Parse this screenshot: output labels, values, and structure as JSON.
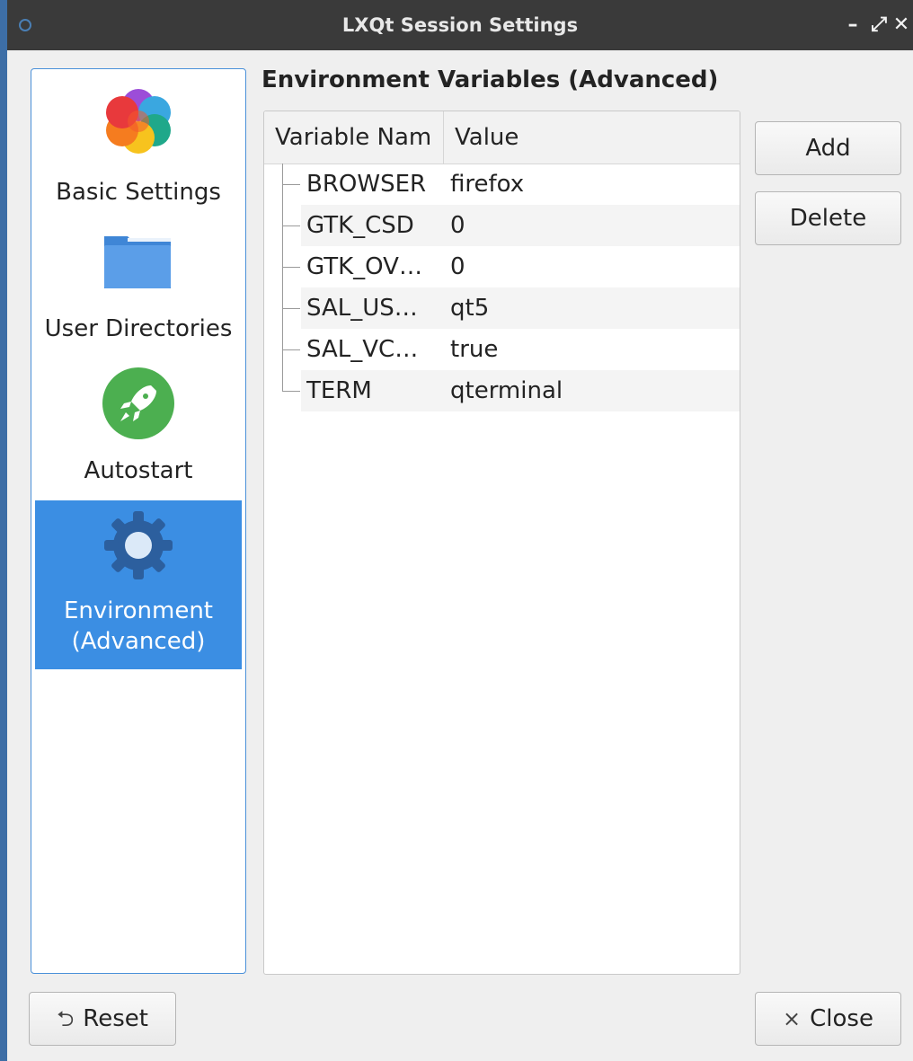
{
  "window": {
    "title": "LXQt Session Settings",
    "minimize_glyph": "–",
    "maximize_glyph": "⤢",
    "close_glyph": "✕"
  },
  "sidebar": {
    "items": [
      {
        "label": "Basic Settings",
        "icon": "preferences-flower-icon"
      },
      {
        "label": "User Directories",
        "icon": "folder-icon"
      },
      {
        "label": "Autostart",
        "icon": "rocket-icon"
      },
      {
        "label": "Environment\n(Advanced)",
        "line1": "Environment",
        "line2": "(Advanced)",
        "icon": "gear-icon",
        "selected": true
      }
    ]
  },
  "main": {
    "title": "Environment Variables (Advanced)",
    "columns": {
      "name": "Variable Nam",
      "value": "Value"
    },
    "rows": [
      {
        "name": "BROWSER",
        "value": "firefox"
      },
      {
        "name": "GTK_CSD",
        "value": "0"
      },
      {
        "name": "GTK_OV…",
        "value": "0"
      },
      {
        "name": "SAL_US…",
        "value": "qt5"
      },
      {
        "name": "SAL_VC…",
        "value": "true"
      },
      {
        "name": "TERM",
        "value": "qterminal"
      }
    ]
  },
  "buttons": {
    "add": "Add",
    "delete": "Delete",
    "reset": "Reset",
    "reset_glyph": "⮌",
    "close": "Close",
    "close_glyph": "×"
  },
  "colors": {
    "selection": "#3b8ee3",
    "titlebar": "#3a3a3a",
    "accent_border": "#4a90d9"
  }
}
